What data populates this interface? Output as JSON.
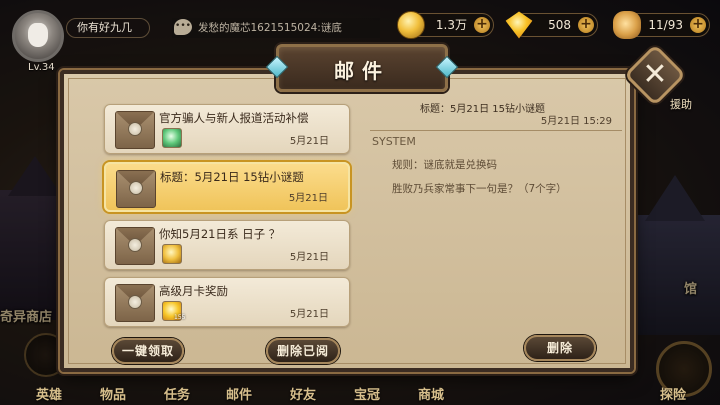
{
  "player": {
    "name": "你有好九几",
    "level": "Lv.34"
  },
  "chat": {
    "icon": "chat-bubble-icon",
    "text": "发愁的魔芯1621515024:谜底"
  },
  "resources": [
    {
      "icon": "gold-coin-icon",
      "value": "1.3万"
    },
    {
      "icon": "diamond-gem-icon",
      "value": "508"
    },
    {
      "icon": "food-stamina-icon",
      "value": "11/93"
    }
  ],
  "dialog": {
    "title": "邮件",
    "close_glyph": "✕",
    "help_label": "援助"
  },
  "mails": [
    {
      "title": "官方骗人与新人报道活动补偿",
      "date": "5月21日",
      "attachment": "jade-item-icon",
      "selected": false
    },
    {
      "title": "标题：5月21日 15钻小谜题",
      "date": "5月21日",
      "attachment": "",
      "selected": true
    },
    {
      "title": "你知5月21日系 日子 ？",
      "date": "5月21日",
      "attachment": "gold-chest-icon",
      "selected": false
    },
    {
      "title": "高级月卡奖励",
      "date": "5月21日",
      "attachment": "diamond-item-icon",
      "attachment_qty": "155",
      "selected": false
    }
  ],
  "buttons": {
    "claim_all": "一键领取",
    "delete_read": "删除已阅",
    "delete": "删除"
  },
  "detail": {
    "subject": "标题：5月21日 15钻小谜题",
    "date": "5月21日 15:29",
    "sender": "SYSTEM",
    "lines": [
      "规则：谜底就是兑换码",
      "胜败乃兵家常事下一句是？（7个字）"
    ]
  },
  "scene": {
    "shop_label": "奇异商店",
    "hall_label": "馆"
  },
  "nav": [
    "英雄",
    "物品",
    "任务",
    "邮件",
    "好友",
    "宝冠",
    "商城",
    "探险"
  ],
  "colors": {
    "panel": "#d4c29f",
    "selected_item": "#f5cf6c",
    "frame": "#3b2c22",
    "accent_gold": "#c89422"
  }
}
